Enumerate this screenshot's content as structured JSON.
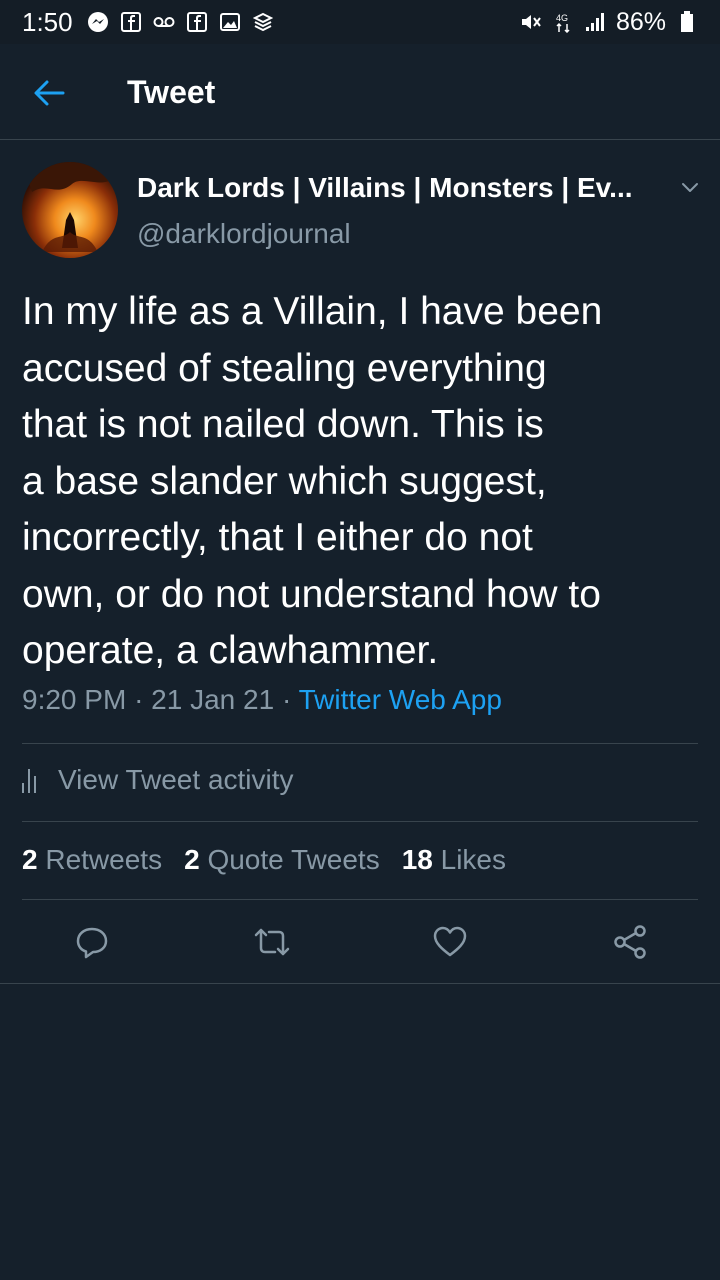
{
  "status_bar": {
    "time": "1:50",
    "battery": "86%",
    "left_icons": [
      "messenger-icon",
      "facebook-icon",
      "voicemail-icon",
      "facebook-icon",
      "gallery-icon",
      "layers-icon"
    ],
    "right_icons": [
      "mute-icon",
      "data-4g-icon",
      "signal-icon",
      "battery-icon"
    ]
  },
  "app_bar": {
    "title": "Tweet"
  },
  "author": {
    "display_name": "Dark Lords | Villains | Monsters | Ev...",
    "handle": "@darklordjournal"
  },
  "tweet": {
    "lines": [
      "In my life as a Villain, I have been",
      "accused of stealing everything",
      "that is not nailed down. This is",
      "a base slander which suggest,",
      "incorrectly, that I either do not",
      "own, or do not understand how to",
      "operate, a clawhammer."
    ],
    "time": "9:20 PM",
    "date": "21 Jan 21",
    "source": "Twitter Web App"
  },
  "activity": {
    "label": "View Tweet activity"
  },
  "stats": {
    "retweets_count": "2",
    "retweets_label": "Retweets",
    "quotes_count": "2",
    "quotes_label": "Quote Tweets",
    "likes_count": "18",
    "likes_label": "Likes"
  },
  "colors": {
    "background": "#15202b",
    "accent": "#1da1f2",
    "secondary_text": "#8899a6",
    "divider": "#38444d"
  }
}
